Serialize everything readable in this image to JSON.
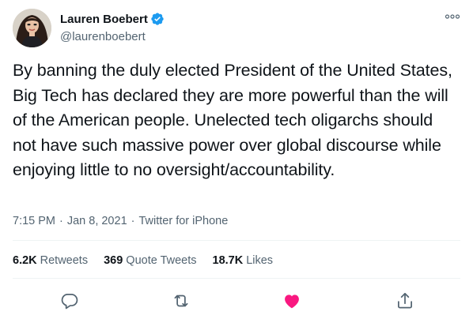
{
  "author": {
    "display_name": "Lauren Boebert",
    "handle": "@laurenboebert",
    "verified_icon": "verified-badge-icon",
    "avatar_icon": "profile-photo"
  },
  "tweet": {
    "text": "By banning the duly elected President of the United States, Big Tech has declared they are more powerful than the will of the American people. Unelected tech oligarchs should not have such massive power over global discourse while enjoying little to no oversight/accountability.",
    "time": "7:15 PM",
    "date": "Jan 8, 2021",
    "separator": "·",
    "source": "Twitter for iPhone"
  },
  "stats": {
    "retweets_count": "6.2K",
    "retweets_label": "Retweets",
    "quotes_count": "369",
    "quotes_label": "Quote Tweets",
    "likes_count": "18.7K",
    "likes_label": "Likes"
  },
  "actions": {
    "reply_icon": "reply-icon",
    "retweet_icon": "retweet-icon",
    "like_icon": "like-icon",
    "share_icon": "share-icon",
    "like_color": "#f91880",
    "icon_color": "#536471"
  },
  "colors": {
    "verified_blue": "#1d9bf0",
    "secondary_text": "#536471",
    "primary_text": "#0f1419",
    "divider": "#eff3f4"
  }
}
